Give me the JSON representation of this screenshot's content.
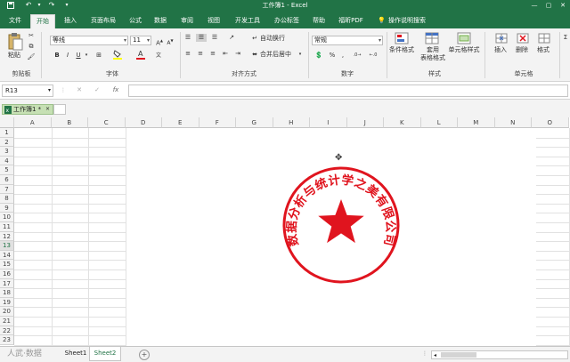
{
  "app": {
    "title": "工作簿1 - Excel",
    "accent_color": "#217346"
  },
  "quick_access": {
    "icons": [
      "save-icon",
      "undo-icon",
      "redo-icon",
      "customize-icon"
    ]
  },
  "window_controls": [
    "minimize-icon",
    "restore-icon",
    "close-icon"
  ],
  "ribbon_tabs": [
    {
      "label": "文件",
      "active": false
    },
    {
      "label": "开始",
      "active": true
    },
    {
      "label": "插入",
      "active": false
    },
    {
      "label": "页面布局",
      "active": false
    },
    {
      "label": "公式",
      "active": false
    },
    {
      "label": "数据",
      "active": false
    },
    {
      "label": "审阅",
      "active": false
    },
    {
      "label": "视图",
      "active": false
    },
    {
      "label": "开发工具",
      "active": false
    },
    {
      "label": "办公标签",
      "active": false
    },
    {
      "label": "帮助",
      "active": false
    },
    {
      "label": "福昕PDF",
      "active": false
    }
  ],
  "tell_me": "操作说明搜索",
  "ribbon": {
    "clipboard": {
      "paste_label": "粘贴",
      "group_label": "剪贴板"
    },
    "font": {
      "font_name": "等线",
      "font_size": "11",
      "group_label": "字体",
      "bold": "B",
      "italic": "I",
      "underline": "U"
    },
    "alignment": {
      "wrap_text": "自动换行",
      "merge_center": "合并后居中",
      "group_label": "对齐方式"
    },
    "number": {
      "format": "常规",
      "group_label": "数字"
    },
    "styles": {
      "conditional": "条件格式",
      "table_line1": "套用",
      "table_line2": "表格格式",
      "cell_styles": "单元格样式",
      "group_label": "样式"
    },
    "cells": {
      "insert": "插入",
      "delete": "删除",
      "format": "格式",
      "group_label": "单元格"
    }
  },
  "formula_bar": {
    "name_box": "R13",
    "fx": "fx",
    "value": ""
  },
  "workbook_tab": {
    "label": "工作簿1 *"
  },
  "grid": {
    "columns": [
      "A",
      "B",
      "C",
      "D",
      "E",
      "F",
      "G",
      "H",
      "I",
      "J",
      "K",
      "L",
      "M",
      "N",
      "O"
    ],
    "rows": [
      "1",
      "2",
      "3",
      "4",
      "5",
      "6",
      "7",
      "8",
      "9",
      "10",
      "11",
      "12",
      "13",
      "14",
      "15",
      "16",
      "17",
      "18",
      "19",
      "20",
      "21",
      "22",
      "23"
    ],
    "selected_row": "13"
  },
  "seal": {
    "text": "数据分析与统计学之美有限公司",
    "color": "#e0141e"
  },
  "sheet_tabs": [
    {
      "label": "Sheet1",
      "active": false
    },
    {
      "label": "Sheet2",
      "active": true
    }
  ],
  "watermark": "人武·数据"
}
